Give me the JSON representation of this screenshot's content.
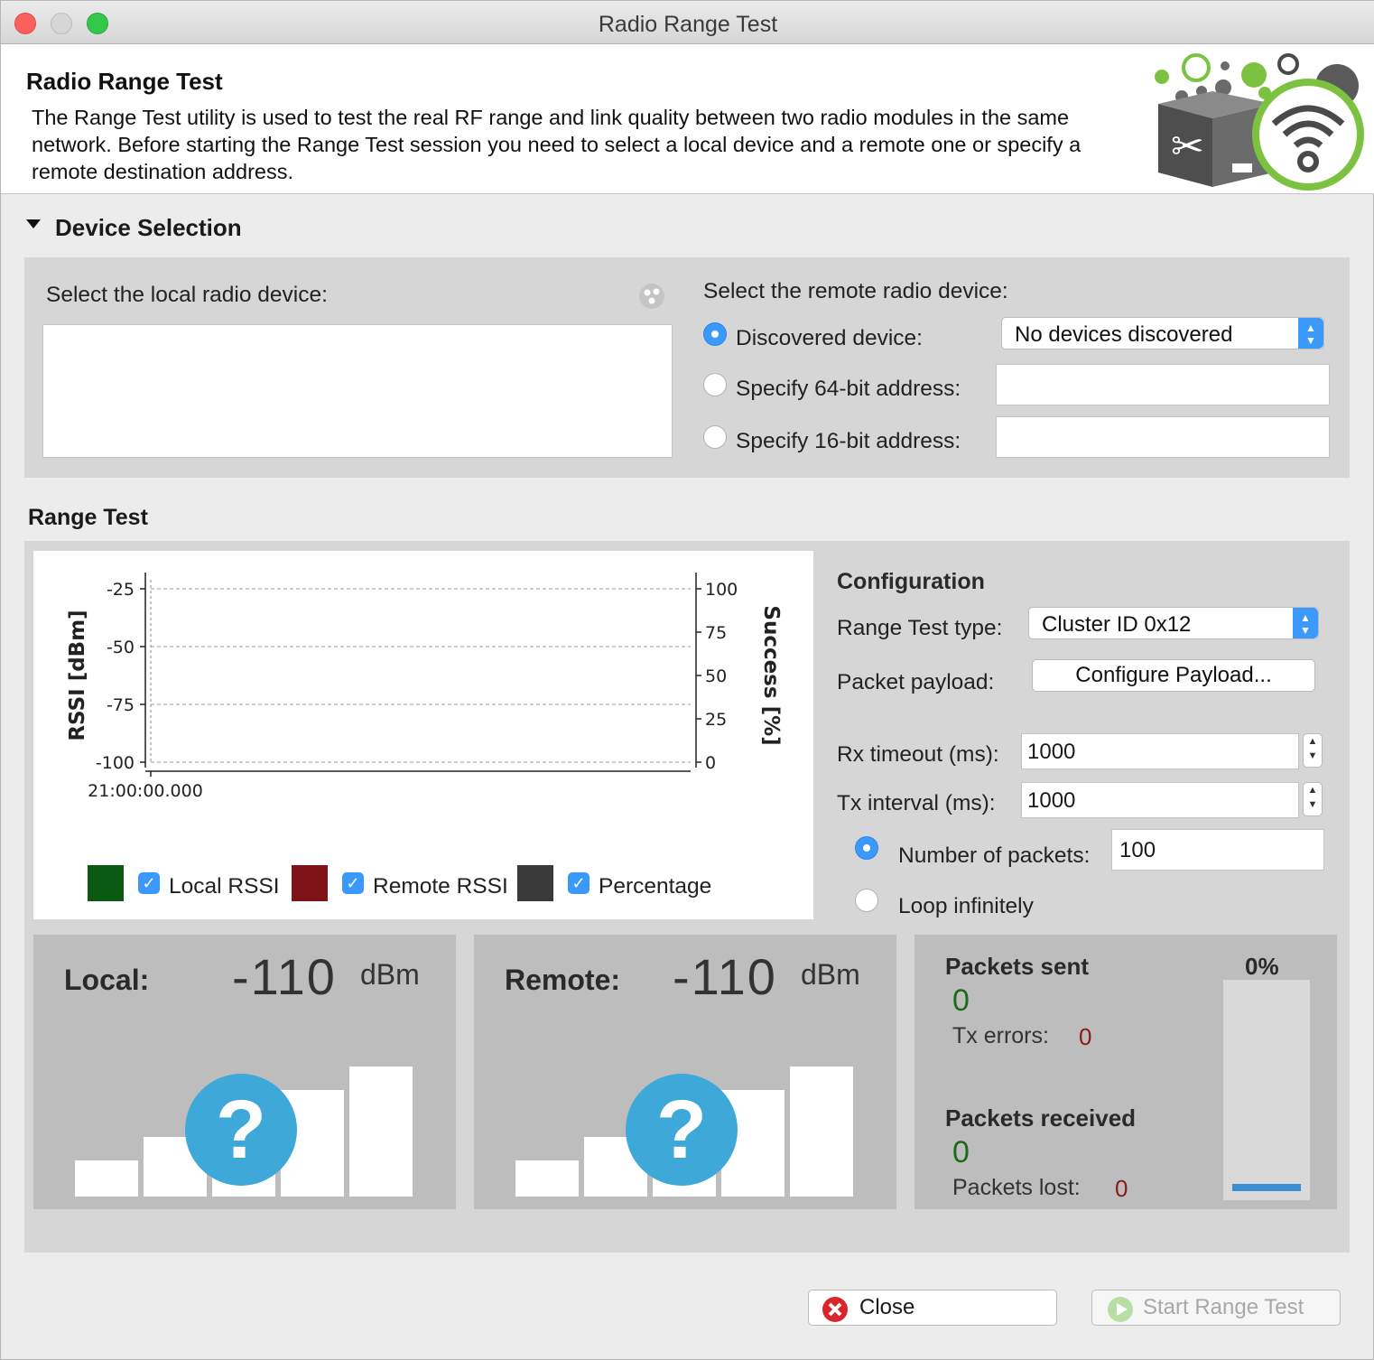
{
  "window": {
    "title": "Radio Range Test"
  },
  "header": {
    "title": "Radio Range Test",
    "description": "The Range Test utility is used to test the real RF range and link quality between two radio modules in the same network. Before starting the Range Test session you need to select a local device and a remote one or specify a remote destination address."
  },
  "device_selection": {
    "title": "Device Selection",
    "local_label": "Select the local radio device:",
    "remote_label": "Select the remote radio device:",
    "options": [
      {
        "label": "Discovered device:",
        "selected": true
      },
      {
        "label": "Specify 64-bit address:",
        "selected": false
      },
      {
        "label": "Specify 16-bit address:",
        "selected": false
      }
    ],
    "discovered_select": "No devices discovered",
    "addr64_value": "",
    "addr16_value": ""
  },
  "range_test": {
    "title": "Range Test",
    "legend": [
      {
        "label": "Local RSSI",
        "color": "#0b5a12",
        "checked": true
      },
      {
        "label": "Remote RSSI",
        "color": "#7f1418",
        "checked": true
      },
      {
        "label": "Percentage",
        "color": "#3a3a3a",
        "checked": true
      }
    ]
  },
  "chart_data": {
    "type": "line",
    "ylabel": "RSSI [dBm]",
    "y2label": "Success [%]",
    "x_ticks": [
      "21:00:00.000"
    ],
    "y_ticks": [
      -25,
      -50,
      -75,
      -100
    ],
    "y2_ticks": [
      100,
      75,
      50,
      25,
      0
    ],
    "ylim": [
      -100,
      -25
    ],
    "y2lim": [
      0,
      100
    ],
    "grid": true,
    "series": []
  },
  "configuration": {
    "title": "Configuration",
    "type_label": "Range Test type:",
    "type_value": "Cluster ID 0x12",
    "payload_label": "Packet payload:",
    "payload_button": "Configure Payload...",
    "rx_label": "Rx timeout (ms):",
    "rx_value": "1000",
    "tx_label": "Tx interval (ms):",
    "tx_value": "1000",
    "packets_label": "Number of packets:",
    "packets_value": "100",
    "packets_selected": true,
    "loop_label": "Loop infinitely",
    "loop_selected": false
  },
  "local": {
    "label": "Local:",
    "value": "-110",
    "unit": "dBm"
  },
  "remote": {
    "label": "Remote:",
    "value": "-110",
    "unit": "dBm"
  },
  "stats": {
    "sent_label": "Packets sent",
    "sent_value": "0",
    "tx_errors_label": "Tx errors:",
    "tx_errors_value": "0",
    "received_label": "Packets received",
    "received_value": "0",
    "lost_label": "Packets lost:",
    "lost_value": "0",
    "percent": "0%",
    "percent_value": 0
  },
  "footer": {
    "close_label": "Close",
    "start_label": "Start Range Test"
  },
  "colors": {
    "accent": "#3b99fc",
    "question": "#3ea8d8",
    "ok_green": "#1b6b1b",
    "err_red": "#8b1a1a"
  }
}
